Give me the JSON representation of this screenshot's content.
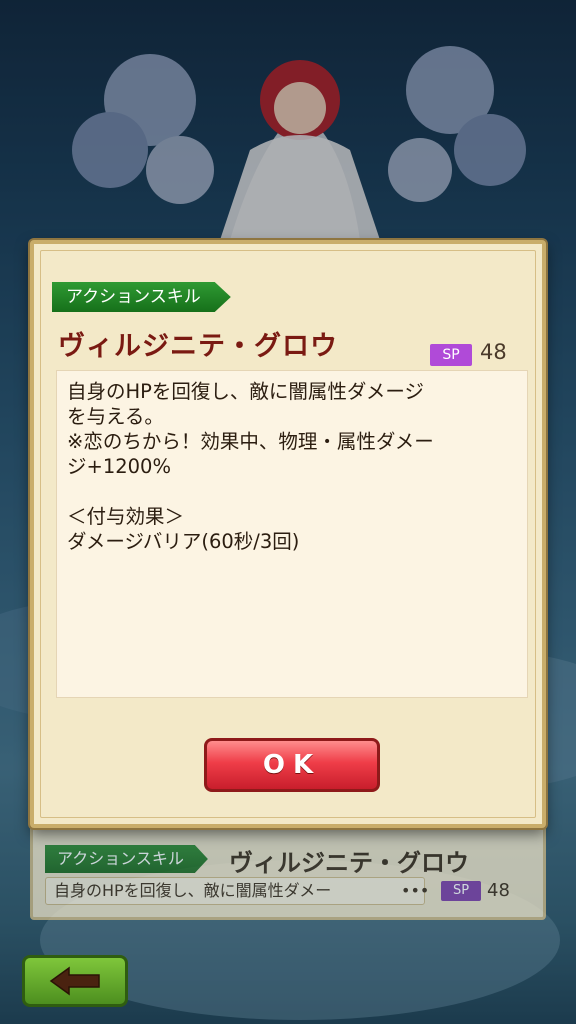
{
  "dialog": {
    "skill_type": "アクションスキル",
    "skill_name": "ヴィルジニテ・グロウ",
    "sp_label": "SP",
    "sp_value": "48",
    "description_lines": [
      "自身のHPを回復し、敵に闇属性ダメージ",
      "を与える。",
      "※恋のちから！効果中、物理・属性ダメー",
      "ジ+1200%",
      "",
      "＜付与効果＞",
      "ダメージバリア(60秒/3回)"
    ],
    "ok_label": "OK"
  },
  "background_list": {
    "skill_type": "アクションスキル",
    "skill_name": "ヴィルジニテ・グロウ",
    "description_preview": "自身のHPを回復し、敵に闇属性ダメー",
    "ellipsis": "•••",
    "sp_label": "SP",
    "sp_value": "48"
  },
  "icons": {
    "back": "arrow-left-icon"
  },
  "colors": {
    "skill_name": "#7a1a12",
    "skill_type_badge": "#2f9a33",
    "sp_badge": "#b04ad8",
    "ok_button": "#ef3d48",
    "back_button": "#7fc63b"
  }
}
